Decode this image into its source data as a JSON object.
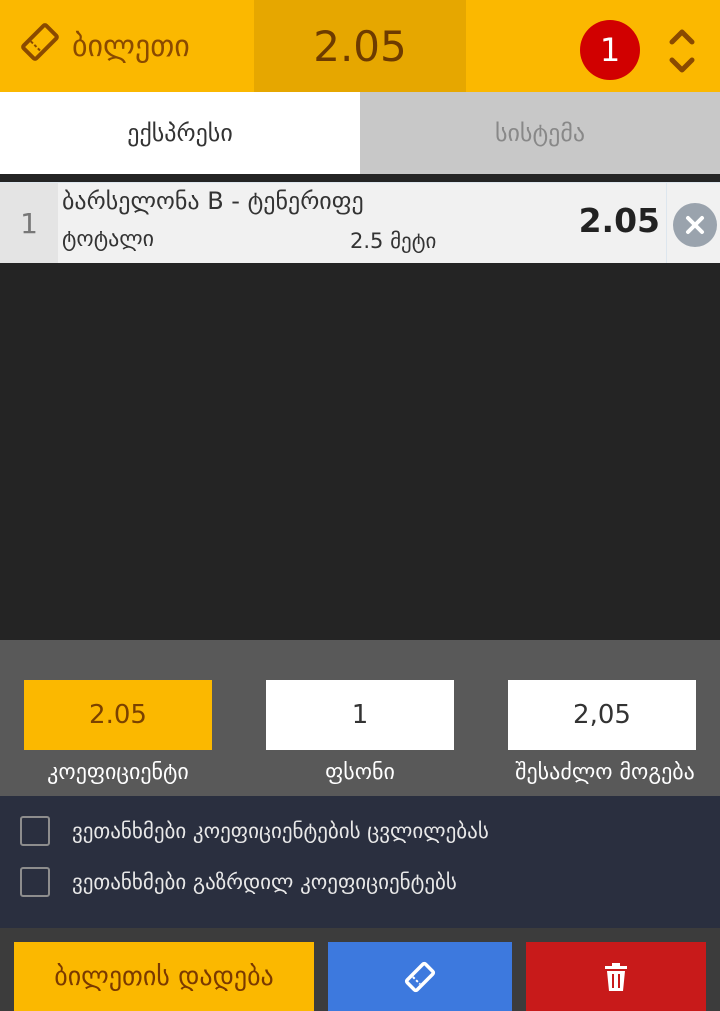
{
  "header": {
    "ticket_label": "ბილეთი",
    "total_odds": "2.05",
    "selections_count": "1",
    "ticket_icon": "ticket-icon",
    "collapse_icon": "chevron-up-down-icon",
    "accent_color": "#fbb800"
  },
  "tabs": [
    {
      "label": "ექსპრესი",
      "active": true
    },
    {
      "label": "სისტემა",
      "active": false
    }
  ],
  "bets": [
    {
      "number": "1",
      "match": "ბარსელონა B - ტენერიფე",
      "market": "ტოტალი",
      "outcome": "2.5 მეტი",
      "odd": "2.05"
    }
  ],
  "calculator": {
    "odds_value": "2.05",
    "odds_label": "კოეფიციენტი",
    "stake_value": "1",
    "stake_label": "ფსონი",
    "win_value": "2,05",
    "win_label": "შესაძლო მოგება"
  },
  "options": [
    {
      "label": "ვეთანხმები კოეფიციენტების ცვლილებას",
      "checked": false
    },
    {
      "label": "ვეთანხმები გაზრდილ კოეფიციენტებს",
      "checked": false
    }
  ],
  "footer": {
    "place_bet_label": "ბილეთის დადება",
    "ticket_button_icon": "ticket-icon",
    "delete_button_icon": "trash-icon"
  }
}
